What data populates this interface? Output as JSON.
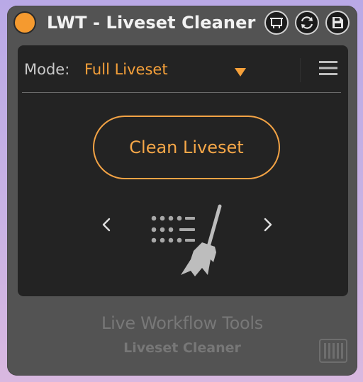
{
  "window": {
    "title": "LWT - Liveset Cleaner",
    "power_icon": "power-dot",
    "title_icons": [
      "freeze-icon",
      "refresh-icon",
      "save-icon"
    ]
  },
  "mode": {
    "label": "Mode:",
    "value": "Full Liveset",
    "arrow_icon": "dropdown-triangle-icon",
    "menu_icon": "hamburger-menu-icon"
  },
  "actions": {
    "clean_label": "Clean Liveset"
  },
  "illustration": {
    "prev_icon": "chevron-left-icon",
    "next_icon": "chevron-right-icon",
    "icons": [
      "dot-grid-icon",
      "broom-icon"
    ]
  },
  "footer": {
    "brand": "Live Workflow Tools",
    "product": "Liveset Cleaner",
    "badge_icon": "barcode-icon"
  },
  "colors": {
    "accent": "#f5a03a",
    "window_bg": "#535353",
    "panel_bg": "#232323",
    "text_light": "#f2f2f2",
    "text_muted": "#787878"
  }
}
